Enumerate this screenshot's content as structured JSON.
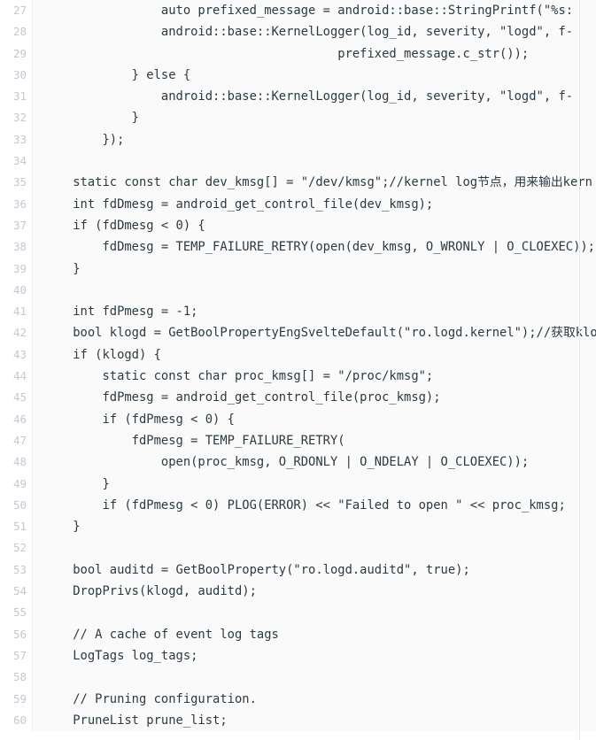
{
  "viewer": {
    "type": "source-code-viewer",
    "language": "cpp",
    "first_line_number": 27,
    "last_line_number": 60,
    "line_height_px": 24.3,
    "font_size_px": 13.8,
    "colors": {
      "code_background": "#fafafa",
      "gutter_background": "#ffffff",
      "gutter_text": "#c3c8d1",
      "code_text": "#2b3a42",
      "gutter_divider": "#ededf0",
      "pane_border": "#e8e8e8"
    }
  },
  "lines": [
    {
      "number": "27",
      "text": "                auto prefixed_message = android::base::StringPrintf(\"%s:"
    },
    {
      "number": "28",
      "text": "                android::base::KernelLogger(log_id, severity, \"logd\", f-"
    },
    {
      "number": "29",
      "text": "                                        prefixed_message.c_str());"
    },
    {
      "number": "30",
      "text": "            } else {"
    },
    {
      "number": "31",
      "text": "                android::base::KernelLogger(log_id, severity, \"logd\", f-"
    },
    {
      "number": "32",
      "text": "            }"
    },
    {
      "number": "33",
      "text": "        });"
    },
    {
      "number": "34",
      "text": ""
    },
    {
      "number": "35",
      "text": "    static const char dev_kmsg[] = \"/dev/kmsg\";//kernel log节点，用来输出kern"
    },
    {
      "number": "36",
      "text": "    int fdDmesg = android_get_control_file(dev_kmsg);"
    },
    {
      "number": "37",
      "text": "    if (fdDmesg < 0) {"
    },
    {
      "number": "38",
      "text": "        fdDmesg = TEMP_FAILURE_RETRY(open(dev_kmsg, O_WRONLY | O_CLOEXEC));"
    },
    {
      "number": "39",
      "text": "    }"
    },
    {
      "number": "40",
      "text": ""
    },
    {
      "number": "41",
      "text": "    int fdPmesg = -1;"
    },
    {
      "number": "42",
      "text": "    bool klogd = GetBoolPropertyEngSvelteDefault(\"ro.logd.kernel\");//获取klo"
    },
    {
      "number": "43",
      "text": "    if (klogd) {"
    },
    {
      "number": "44",
      "text": "        static const char proc_kmsg[] = \"/proc/kmsg\";"
    },
    {
      "number": "45",
      "text": "        fdPmesg = android_get_control_file(proc_kmsg);"
    },
    {
      "number": "46",
      "text": "        if (fdPmesg < 0) {"
    },
    {
      "number": "47",
      "text": "            fdPmesg = TEMP_FAILURE_RETRY("
    },
    {
      "number": "48",
      "text": "                open(proc_kmsg, O_RDONLY | O_NDELAY | O_CLOEXEC));"
    },
    {
      "number": "49",
      "text": "        }"
    },
    {
      "number": "50",
      "text": "        if (fdPmesg < 0) PLOG(ERROR) << \"Failed to open \" << proc_kmsg;"
    },
    {
      "number": "51",
      "text": "    }"
    },
    {
      "number": "52",
      "text": ""
    },
    {
      "number": "53",
      "text": "    bool auditd = GetBoolProperty(\"ro.logd.auditd\", true);"
    },
    {
      "number": "54",
      "text": "    DropPrivs(klogd, auditd);"
    },
    {
      "number": "55",
      "text": ""
    },
    {
      "number": "56",
      "text": "    // A cache of event log tags"
    },
    {
      "number": "57",
      "text": "    LogTags log_tags;"
    },
    {
      "number": "58",
      "text": ""
    },
    {
      "number": "59",
      "text": "    // Pruning configuration."
    },
    {
      "number": "60",
      "text": "    PruneList prune_list;"
    }
  ]
}
